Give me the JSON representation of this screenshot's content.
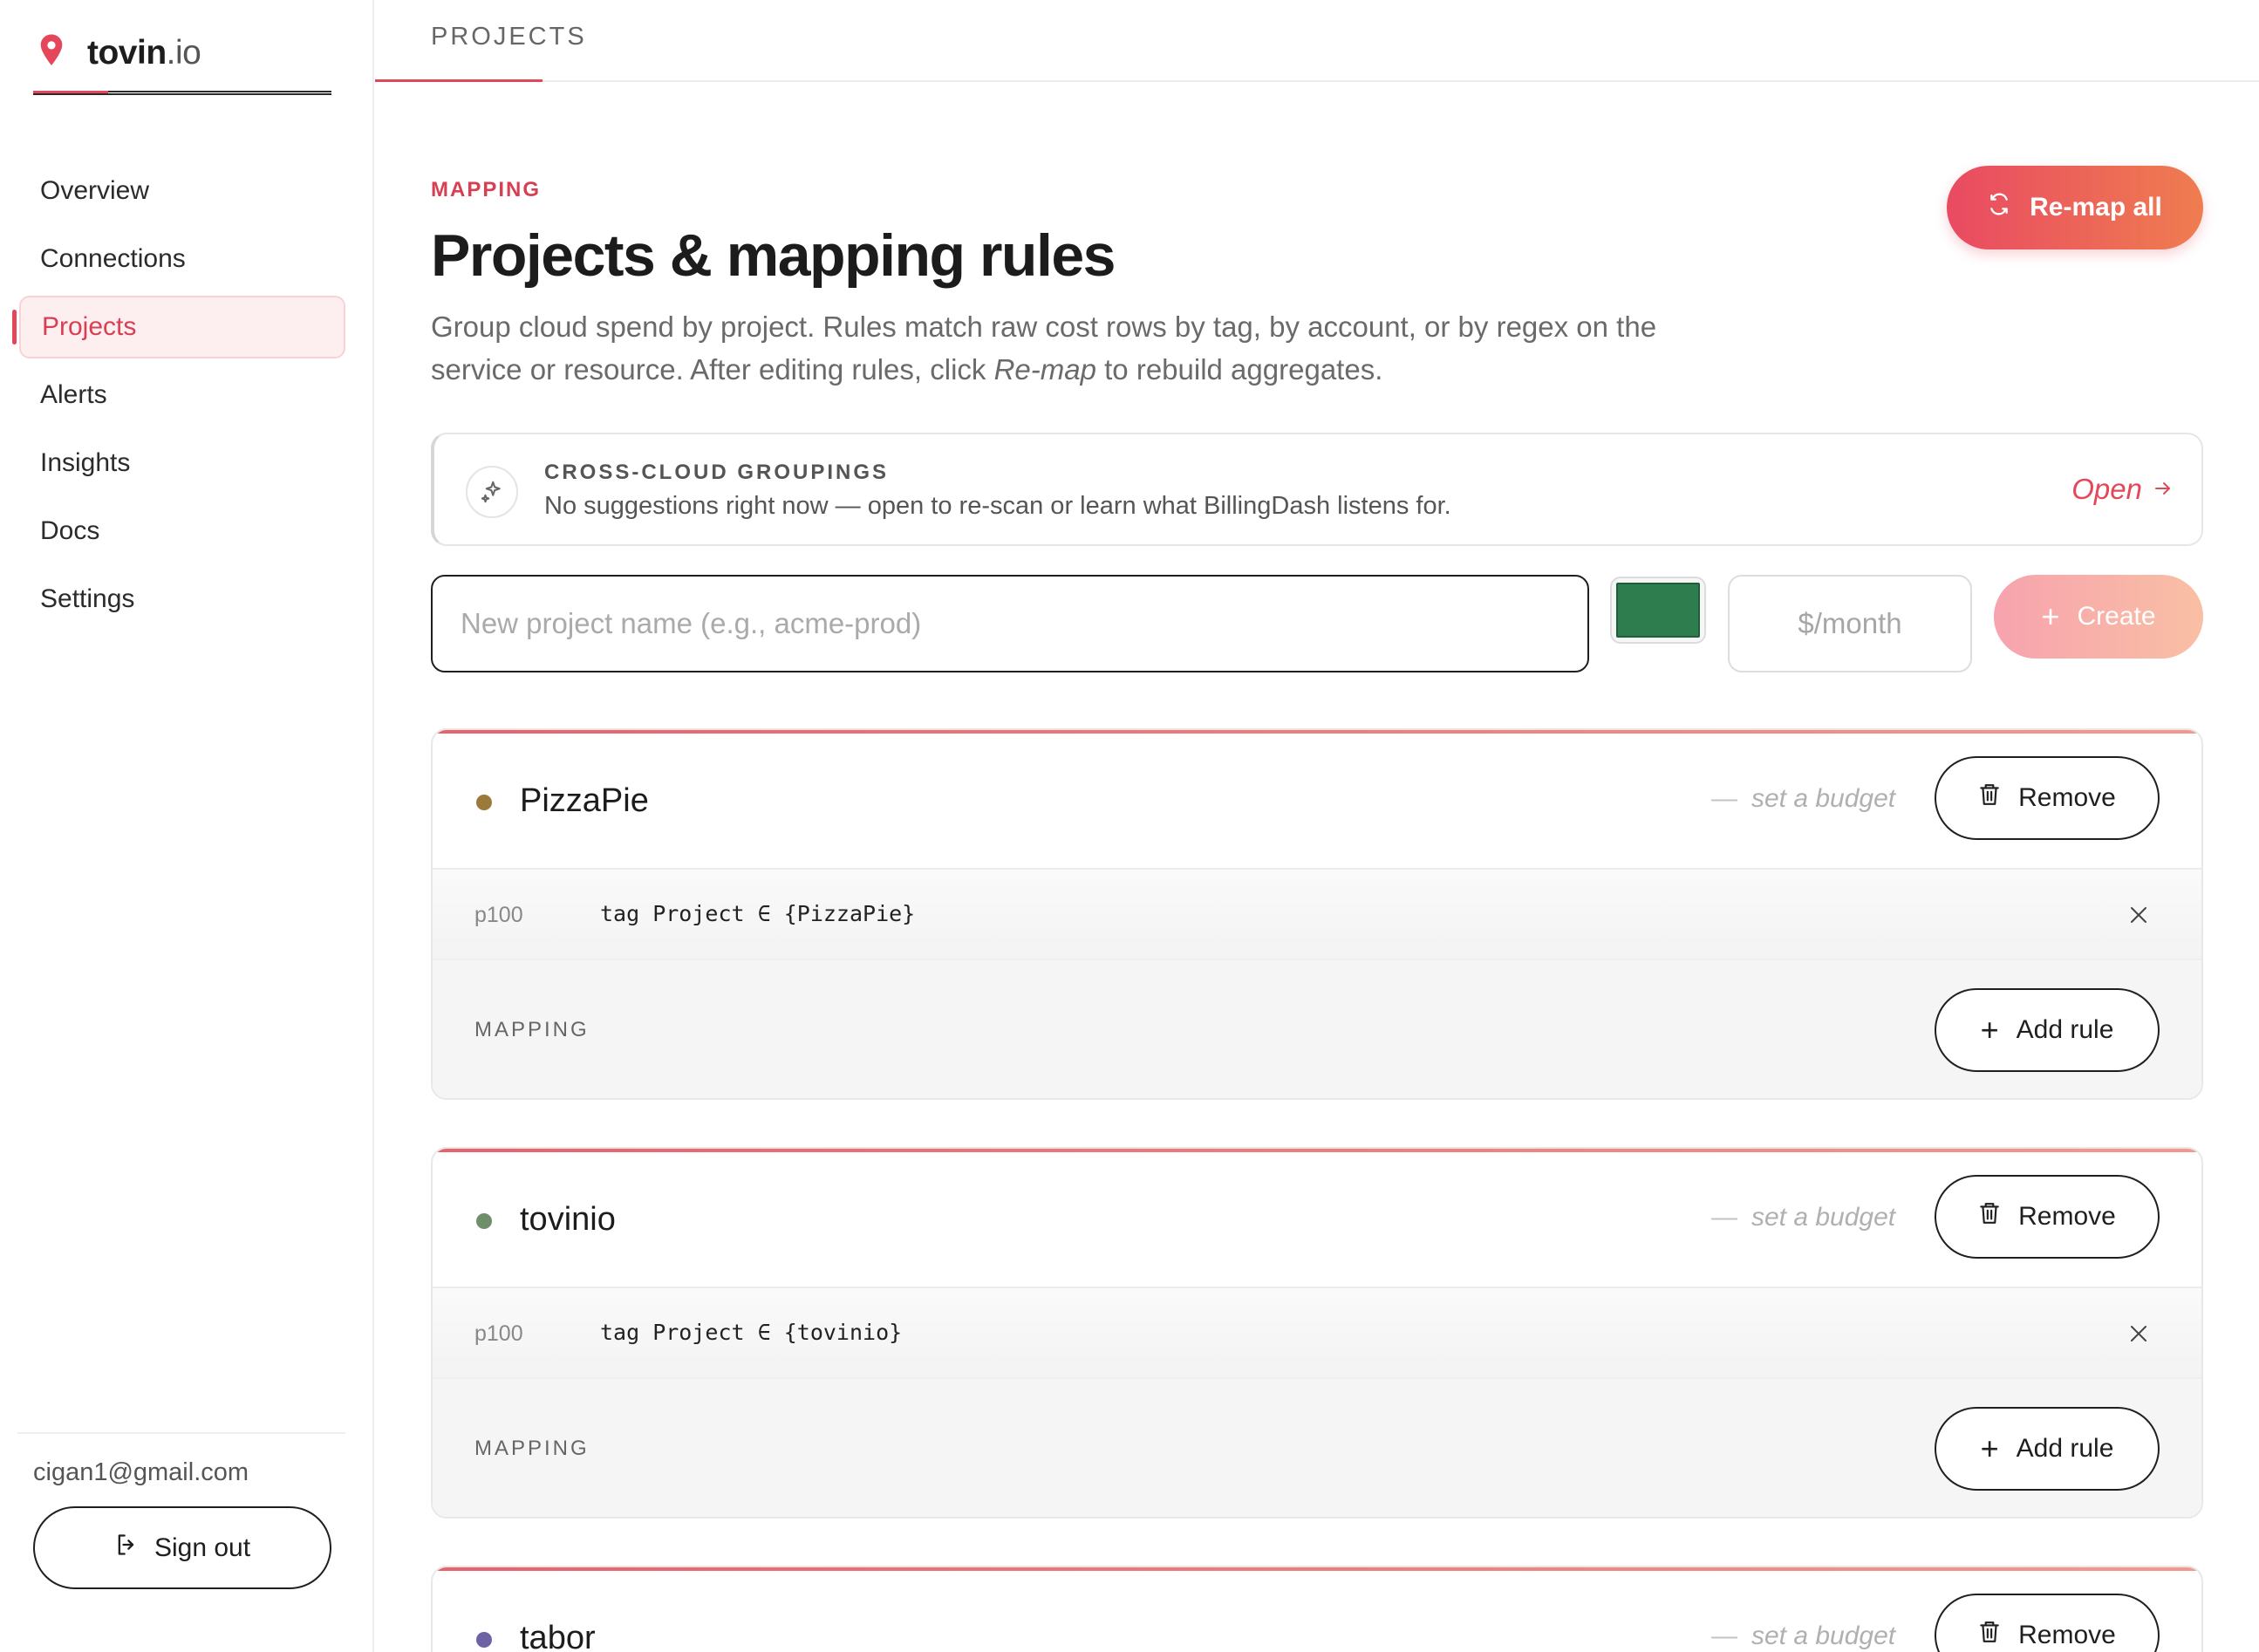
{
  "brand": {
    "name": "tovin",
    "suffix": ".io"
  },
  "sidebar": {
    "items": [
      {
        "label": "Overview",
        "active": false
      },
      {
        "label": "Connections",
        "active": false
      },
      {
        "label": "Projects",
        "active": true
      },
      {
        "label": "Alerts",
        "active": false
      },
      {
        "label": "Insights",
        "active": false
      },
      {
        "label": "Docs",
        "active": false
      },
      {
        "label": "Settings",
        "active": false
      }
    ],
    "email": "cigan1@gmail.com",
    "signout_label": "Sign out"
  },
  "topbar": {
    "title": "PROJECTS"
  },
  "header": {
    "eyebrow": "MAPPING",
    "title": "Projects & mapping rules",
    "desc_part1": "Group cloud spend by project. Rules match raw cost rows by tag, by account, or by regex on the service or resource. After editing rules, click ",
    "desc_em": "Re-map",
    "desc_part2": " to rebuild aggregates.",
    "remap_label": "Re-map all"
  },
  "suggestions": {
    "title": "CROSS-CLOUD GROUPINGS",
    "text": "No suggestions right now — open to re-scan or learn what BillingDash listens for.",
    "open_label": "Open"
  },
  "new_project": {
    "name_placeholder": "New project name (e.g., acme-prod)",
    "color": "#2e7d4f",
    "budget_placeholder": "$/month",
    "create_label": "Create"
  },
  "colors": {
    "accent": "#e4475a",
    "accent_orange": "#ef7d50"
  },
  "projects": [
    {
      "name": "PizzaPie",
      "color": "#9b7a3c",
      "budget_label": "set a budget",
      "remove_label": "Remove",
      "rule_priority": "p100",
      "rule_expr": "tag Project ∈ {PizzaPie}",
      "mapping_label": "MAPPING",
      "add_rule_label": "Add rule"
    },
    {
      "name": "tovinio",
      "color": "#6f8f6a",
      "budget_label": "set a budget",
      "remove_label": "Remove",
      "rule_priority": "p100",
      "rule_expr": "tag Project ∈ {tovinio}",
      "mapping_label": "MAPPING",
      "add_rule_label": "Add rule"
    },
    {
      "name": "tabor",
      "color": "#6d63a3",
      "budget_label": "set a budget",
      "remove_label": "Remove"
    }
  ]
}
